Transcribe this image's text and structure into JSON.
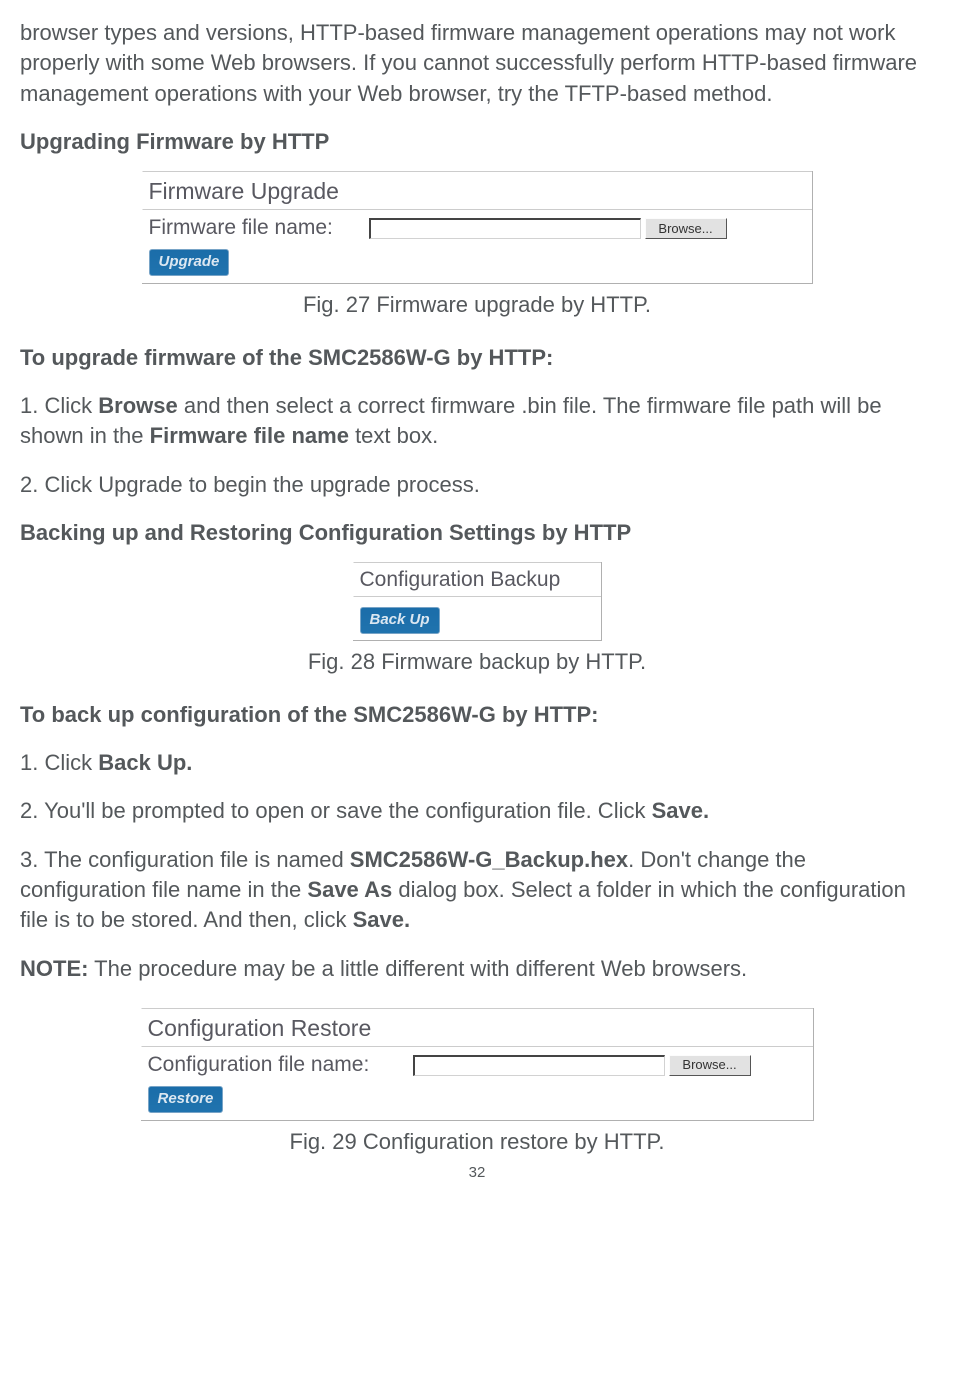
{
  "intro_paragraph": "browser types and versions, HTTP-based firmware management operations may not work properly with some Web browsers. If you cannot successfully perform HTTP-based firmware management operations with your Web browser, try the TFTP-based method.",
  "heading1": "Upgrading Firmware by HTTP",
  "fig27": {
    "title": "Firmware Upgrade",
    "label": "Firmware file name:",
    "browse": "Browse...",
    "upgrade": "Upgrade",
    "caption": "Fig. 27 Firmware upgrade by HTTP."
  },
  "upgrade_procedure_heading": "To upgrade firmware of the SMC2586W-G by HTTP:",
  "step1_a": "1. Click ",
  "step1_b": "Browse",
  "step1_c": " and then select a correct firmware .bin file. The firmware file path will be shown in the ",
  "step1_d": "Firmware file name",
  "step1_e": " text box.",
  "step2": "2. Click Upgrade to begin the upgrade process.",
  "heading2": "Backing up and Restoring Configuration Settings by HTTP",
  "fig28": {
    "title": "Configuration Backup",
    "backup": "Back Up",
    "caption": "Fig. 28 Firmware backup by HTTP."
  },
  "backup_procedure_heading": "To back up configuration of the SMC2586W-G by HTTP:",
  "bstep1_a": "1. Click ",
  "bstep1_b": "Back Up.",
  "bstep2_a": "2. You'll be prompted to open or save the configuration file. Click ",
  "bstep2_b": "Save.",
  "bstep3_a": "3. The configuration file is named ",
  "bstep3_b": "SMC2586W-G_Backup.hex",
  "bstep3_c": ". Don't change the configuration file name in the ",
  "bstep3_d": "Save As",
  "bstep3_e": " dialog box. Select a folder in which the configuration file is to be stored. And then, click ",
  "bstep3_f": "Save.",
  "note_a": "NOTE:",
  "note_b": " The procedure may be a little different with different Web browsers.",
  "fig29": {
    "title": "Configuration Restore",
    "label": "Configuration file name:",
    "browse": "Browse...",
    "restore": "Restore",
    "caption": "Fig. 29 Configuration restore by HTTP."
  },
  "page_number": "32"
}
